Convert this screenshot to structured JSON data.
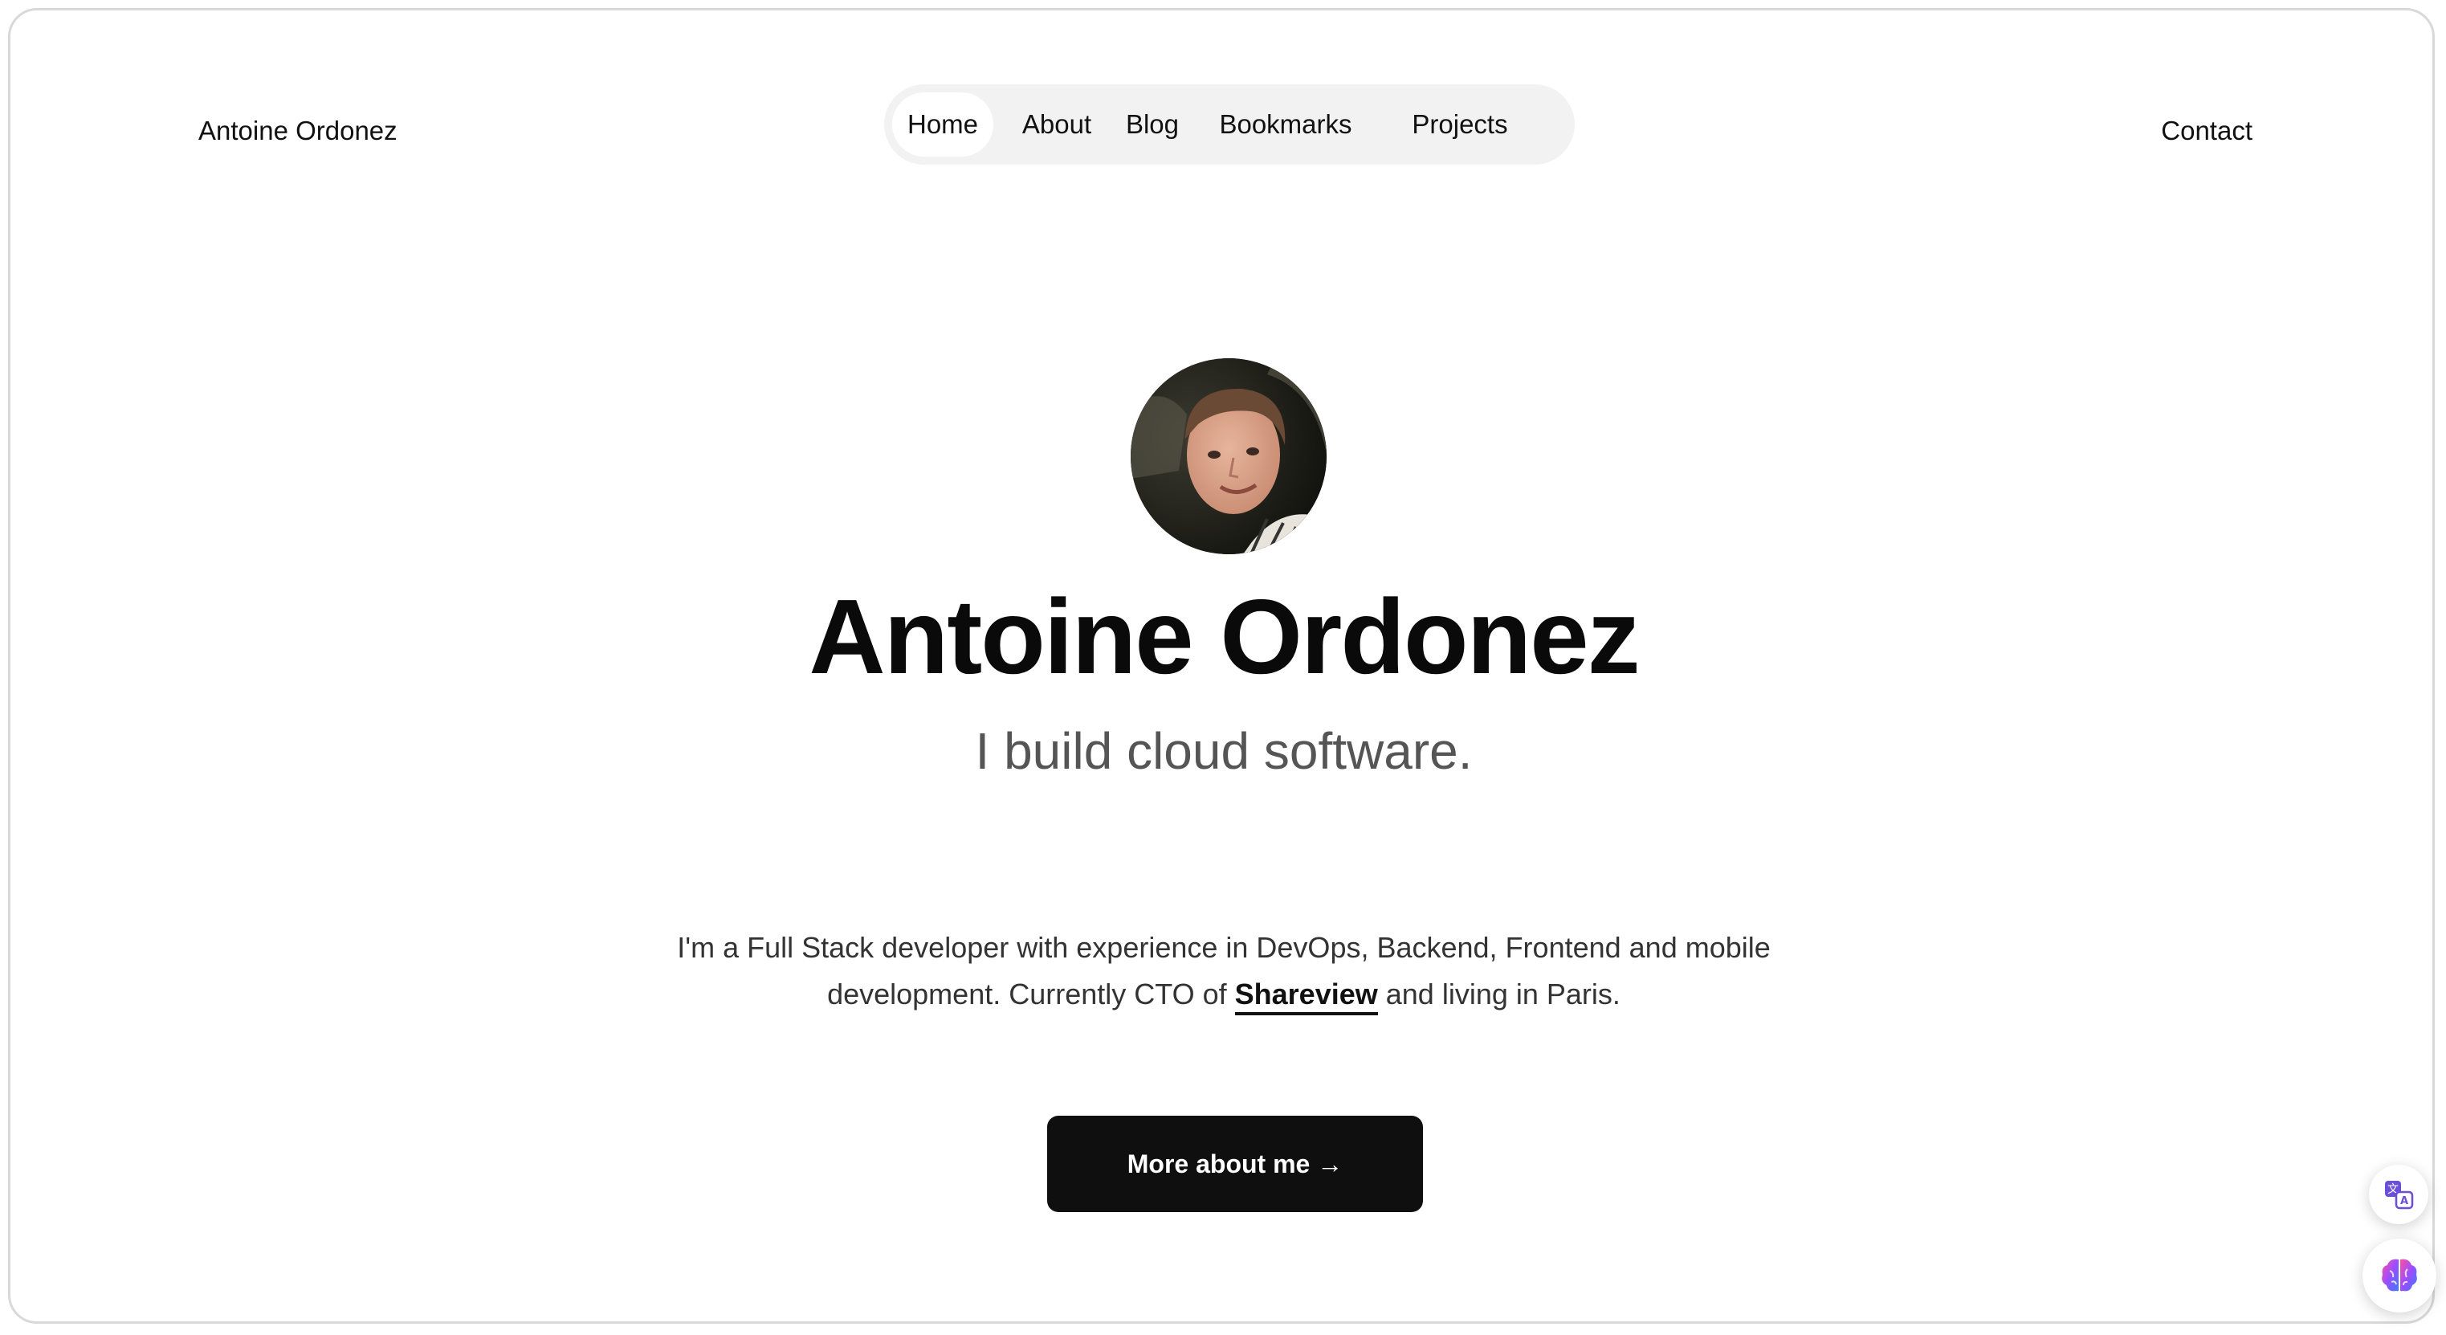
{
  "header": {
    "brand": "Antoine Ordonez",
    "nav": [
      {
        "label": "Home",
        "active": true
      },
      {
        "label": "About",
        "active": false
      },
      {
        "label": "Blog",
        "active": false
      },
      {
        "label": "Bookmarks",
        "active": false
      },
      {
        "label": "Projects",
        "active": false
      }
    ],
    "contact": "Contact"
  },
  "hero": {
    "name": "Antoine Ordonez",
    "tagline": "I build cloud software."
  },
  "intro": {
    "text_before": "I'm a Full Stack developer with experience in DevOps, Backend, Frontend and mobile development. Currently CTO of ",
    "company": "Shareview",
    "text_after": " and living in Paris."
  },
  "cta": {
    "label": "More about me →"
  },
  "floating": {
    "translate_icon": "translate-icon",
    "brain_icon": "brain-icon"
  },
  "colors": {
    "nav_pill": "#f2f2f2",
    "cta_background": "#0f0f0f",
    "subtitle": "#555555"
  }
}
